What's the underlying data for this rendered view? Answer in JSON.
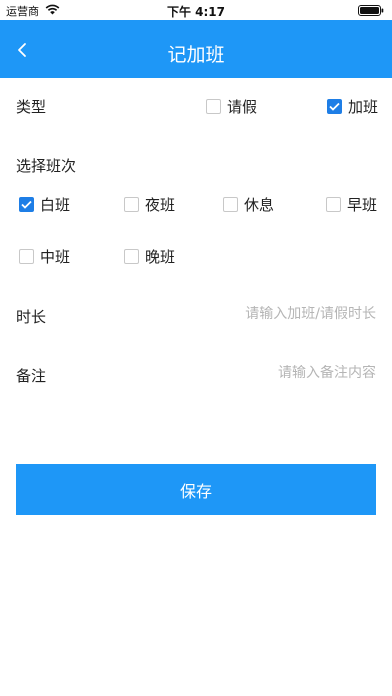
{
  "status_bar": {
    "carrier": "运营商",
    "time": "下午 4:17"
  },
  "nav": {
    "title": "记加班",
    "back_icon": "chevron-left-icon"
  },
  "type_section": {
    "label": "类型",
    "options": [
      {
        "label": "请假",
        "checked": false
      },
      {
        "label": "加班",
        "checked": true
      }
    ]
  },
  "shift_section": {
    "label": "选择班次",
    "options": [
      {
        "label": "白班",
        "checked": true
      },
      {
        "label": "夜班",
        "checked": false
      },
      {
        "label": "休息",
        "checked": false
      },
      {
        "label": "早班",
        "checked": false
      },
      {
        "label": "中班",
        "checked": false
      },
      {
        "label": "晚班",
        "checked": false
      }
    ]
  },
  "duration": {
    "label": "时长",
    "value": "",
    "placeholder": "请输入加班/请假时长"
  },
  "remark": {
    "label": "备注",
    "value": "",
    "placeholder": "请输入备注内容"
  },
  "save_label": "保存",
  "colors": {
    "accent": "#1e97f7",
    "checkbox_checked": "#1e7ee6",
    "placeholder": "#b5b5b5"
  }
}
